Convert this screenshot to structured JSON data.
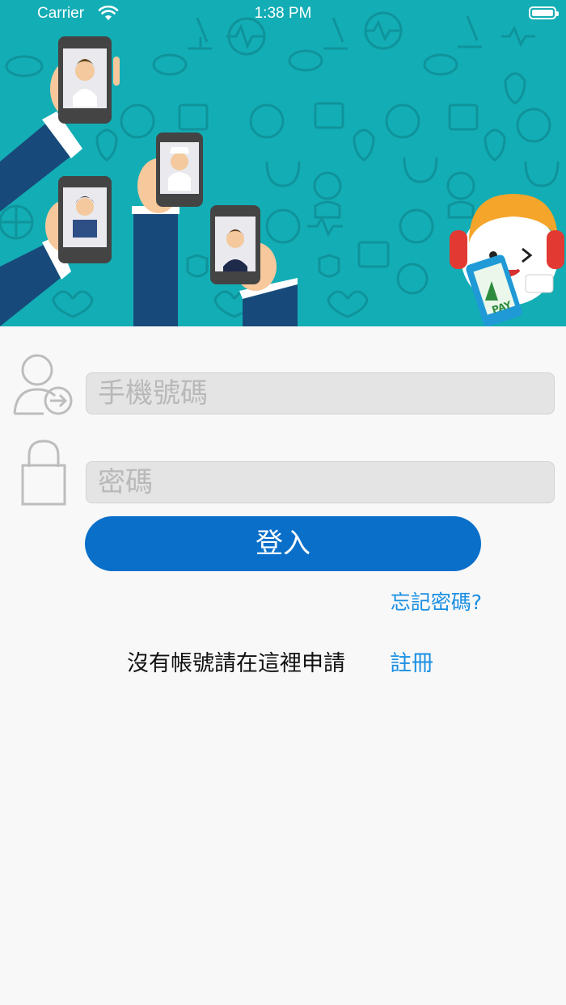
{
  "status_bar": {
    "carrier": "Carrier",
    "time": "1:38 PM"
  },
  "banner": {
    "logo_text": "PAY"
  },
  "login_form": {
    "phone_placeholder": "手機號碼",
    "password_placeholder": "密碼",
    "login_label": "登入",
    "forgot_label": "忘記密碼?",
    "register_prompt": "沒有帳號請在這裡申請",
    "register_label": "註冊"
  },
  "colors": {
    "banner_bg": "#13adb5",
    "primary": "#0a6fc9",
    "link": "#1a8fe3"
  }
}
